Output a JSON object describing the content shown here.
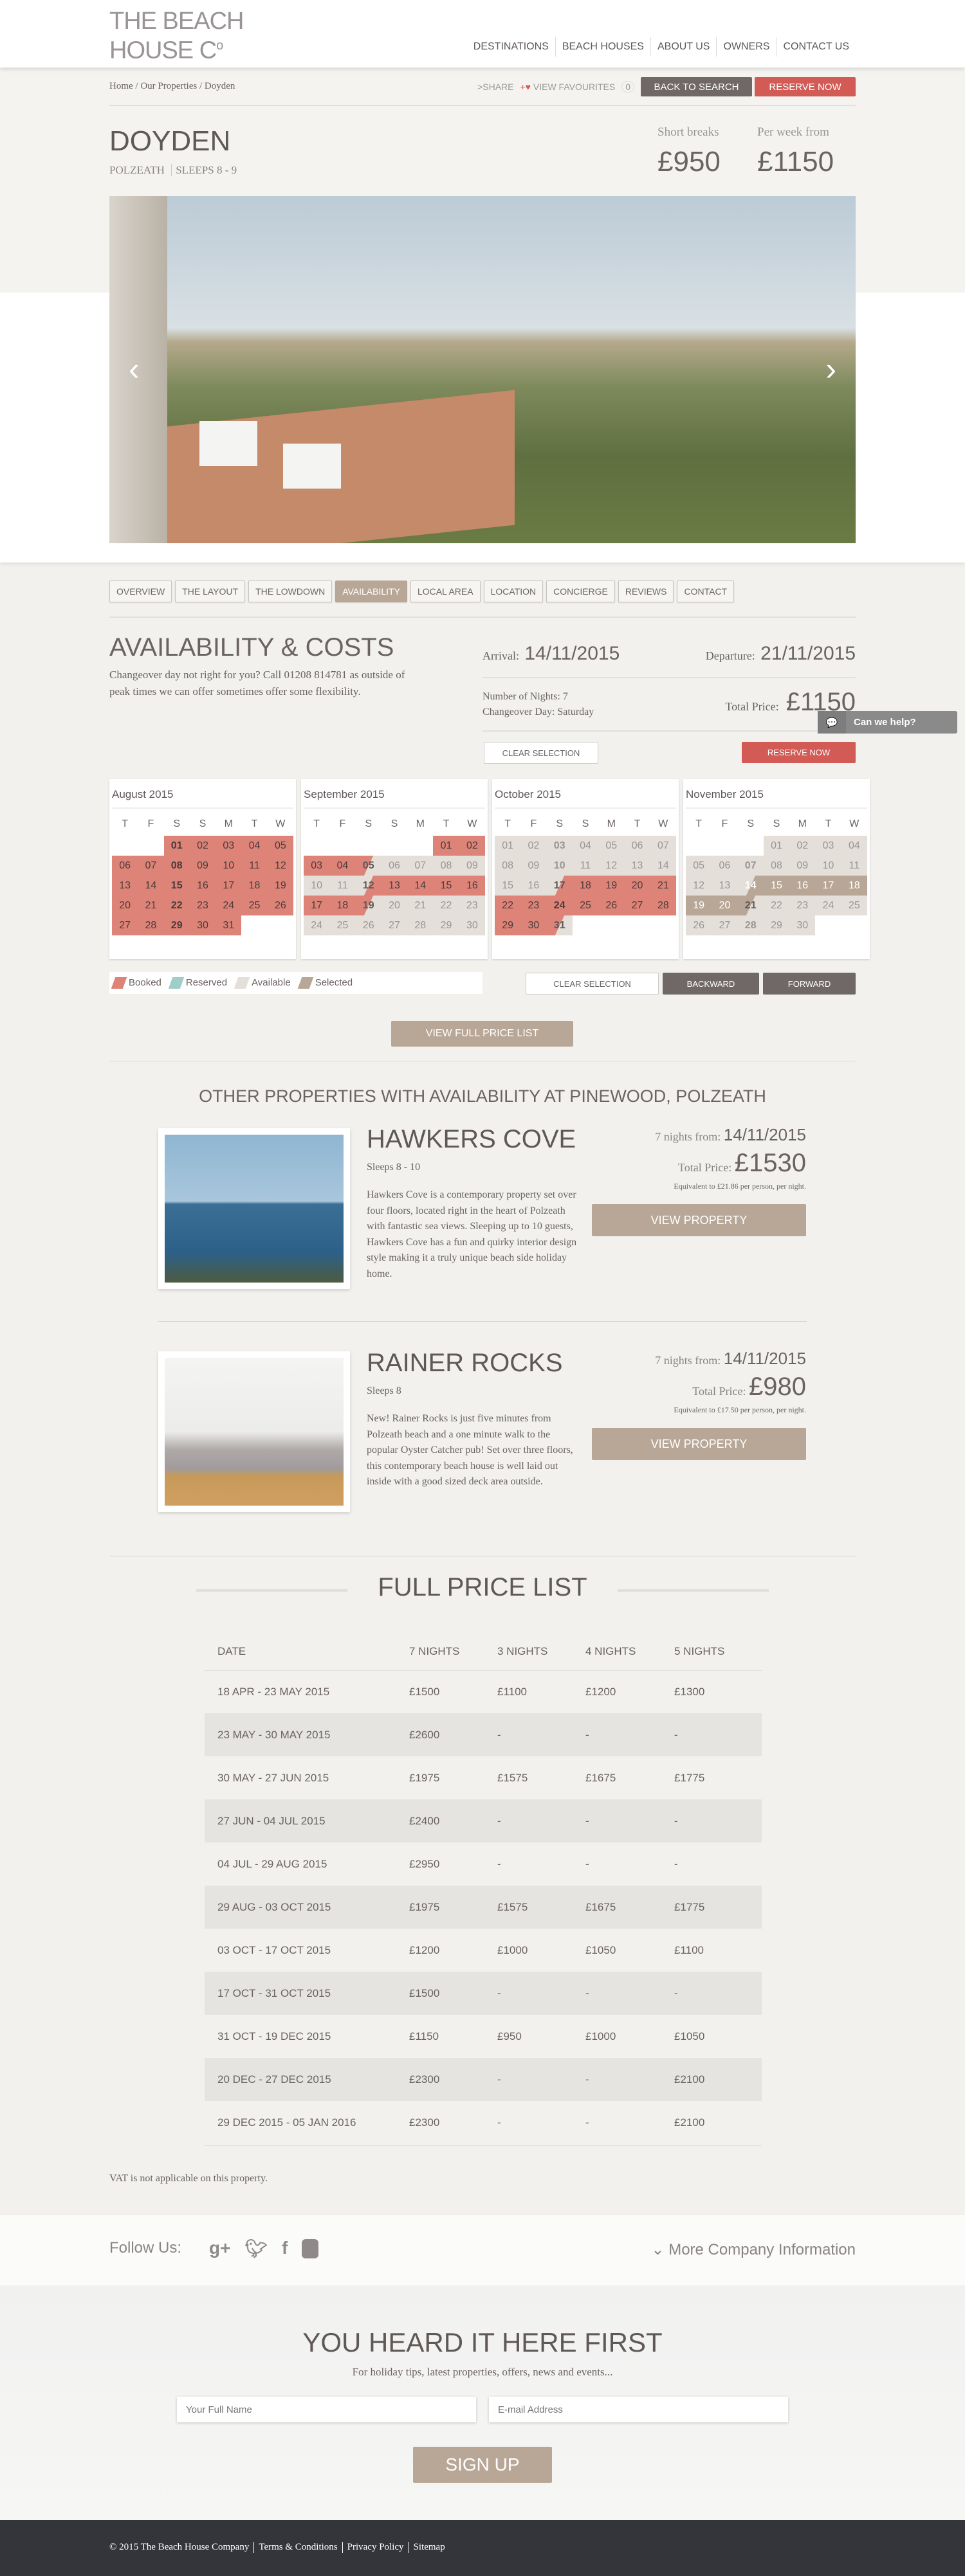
{
  "header": {
    "logo": "THE BEACH HOUSE Co",
    "nav": [
      "DESTINATIONS",
      "BEACH HOUSES",
      "ABOUT US",
      "OWNERS",
      "CONTACT US"
    ]
  },
  "toolbar": {
    "breadcrumb": "Home / Our Properties / Doyden",
    "share": "SHARE",
    "favourites": "VIEW FAVOURITES",
    "fav_count": "0",
    "back": "BACK TO SEARCH",
    "reserve": "RESERVE NOW"
  },
  "property": {
    "name": "DOYDEN",
    "location": "POLZEATH",
    "sleeps": "SLEEPS 8 - 9",
    "short_label": "Short breaks",
    "short_price": "£950",
    "week_label": "Per week from",
    "week_price": "£1150"
  },
  "tabs": [
    "OVERVIEW",
    "THE LAYOUT",
    "THE LOWDOWN",
    "AVAILABILITY",
    "LOCAL AREA",
    "LOCATION",
    "CONCIERGE",
    "REVIEWS",
    "CONTACT"
  ],
  "active_tab": "AVAILABILITY",
  "availability": {
    "title": "AVAILABILITY & COSTS",
    "text": "Changeover day not right for you? Call 01208 814781 as outside of peak times we can offer sometimes offer some flexibility.",
    "arrival_label": "Arrival:",
    "arrival": "14/11/2015",
    "departure_label": "Departure:",
    "departure": "21/11/2015",
    "nights": "Number of Nights: 7",
    "changeover": "Changeover Day: Saturday",
    "total_label": "Total Price:",
    "total": "£1150",
    "clear": "CLEAR SELECTION",
    "reserve": "RESERVE NOW"
  },
  "calendar": {
    "weekdays": [
      "T",
      "F",
      "S",
      "S",
      "M",
      "T",
      "W"
    ],
    "months": [
      {
        "name": "August 2015",
        "offset": 2,
        "states": "B*31",
        "bold": [
          1,
          8,
          15,
          22,
          29
        ]
      },
      {
        "name": "September 2015",
        "offset": 5,
        "states": "B,B,B,B,BA,A,A,A,A,A,A,AB,B,B,B,B,B,B,BA,A,A,A,A,A,A,A,A,A,A,A",
        "bold": [
          5,
          12,
          19
        ]
      },
      {
        "name": "October 2015",
        "offset": 0,
        "states": "A,A,A,A,A,A,A,A,A,A,A,A,A,A,A,A,AB,B,B,B,B,B,B,B,B,B,B,B,B,B,BA",
        "bold": [
          3,
          10,
          17,
          24,
          31
        ]
      },
      {
        "name": "November 2015",
        "offset": 3,
        "states": "A,A,A,A,A,A,A,A,A,A,A,A,A,AS,S,S,S,S,S,S,SA,A,A,A,A,A,A,A,A,A",
        "bold": [
          7,
          14,
          21,
          28
        ]
      }
    ],
    "legend": [
      "Booked",
      "Reserved",
      "Available",
      "Selected"
    ],
    "legend_colors": [
      "#dd8378",
      "#9fcdc8",
      "#e5dfda",
      "#b8a796"
    ],
    "clear": "CLEAR SELECTION",
    "backward": "BACKWARD",
    "forward": "FORWARD",
    "full_list": "VIEW FULL PRICE LIST"
  },
  "others": {
    "title": "OTHER PROPERTIES WITH AVAILABILITY AT PINEWOOD, POLZEATH",
    "items": [
      {
        "name": "HAWKERS COVE",
        "sleeps": "Sleeps 8 - 10",
        "desc": "Hawkers Cove is a contemporary property set over four floors, located right in the heart of Polzeath with fantastic sea views. Sleeping up to 10 guests, Hawkers Cove has a fun and quirky interior design style making it a truly unique beach side holiday home.",
        "from_label": "7 nights from:",
        "from": "14/11/2015",
        "total_label": "Total Price:",
        "total": "£1530",
        "equiv": "Equivalent to £21.86 per person, per night.",
        "button": "VIEW PROPERTY"
      },
      {
        "name": "RAINER ROCKS",
        "sleeps": "Sleeps 8",
        "desc": "New! Rainer Rocks is just five minutes from Polzeath beach and a one minute walk to the popular Oyster Catcher pub! Set over three floors, this contemporary beach house is well laid out inside with a good sized deck area outside.",
        "from_label": "7 nights from:",
        "from": "14/11/2015",
        "total_label": "Total Price:",
        "total": "£980",
        "equiv": "Equivalent to £17.50 per person, per night.",
        "button": "VIEW PROPERTY"
      }
    ]
  },
  "price_list": {
    "title": "FULL PRICE LIST",
    "headers": [
      "DATE",
      "7 NIGHTS",
      "3 NIGHTS",
      "4 NIGHTS",
      "5 NIGHTS"
    ],
    "rows": [
      [
        "18 APR - 23 MAY 2015",
        "£1500",
        "£1100",
        "£1200",
        "£1300"
      ],
      [
        "23 MAY - 30 MAY 2015",
        "£2600",
        "-",
        "-",
        "-"
      ],
      [
        "30 MAY - 27 JUN 2015",
        "£1975",
        "£1575",
        "£1675",
        "£1775"
      ],
      [
        "27 JUN - 04 JUL 2015",
        "£2400",
        "-",
        "-",
        "-"
      ],
      [
        "04 JUL - 29 AUG 2015",
        "£2950",
        "-",
        "-",
        "-"
      ],
      [
        "29 AUG - 03 OCT 2015",
        "£1975",
        "£1575",
        "£1675",
        "£1775"
      ],
      [
        "03 OCT - 17 OCT 2015",
        "£1200",
        "£1000",
        "£1050",
        "£1100"
      ],
      [
        "17 OCT - 31 OCT 2015",
        "£1500",
        "-",
        "-",
        "-"
      ],
      [
        "31 OCT - 19 DEC 2015",
        "£1150",
        "£950",
        "£1000",
        "£1050"
      ],
      [
        "20 DEC - 27 DEC 2015",
        "£2300",
        "-",
        "-",
        "£2100"
      ],
      [
        "29 DEC 2015 - 05 JAN 2016",
        "£2300",
        "-",
        "-",
        "£2100"
      ]
    ],
    "vat": "VAT is not applicable on this property."
  },
  "follow": {
    "label": "Follow Us:",
    "more": "More Company Information"
  },
  "newsletter": {
    "title": "YOU HEARD IT HERE FIRST",
    "text": "For holiday tips, latest properties, offers, news and events...",
    "name_placeholder": "Your Full Name",
    "email_placeholder": "E-mail Address",
    "button": "SIGN UP"
  },
  "footer": {
    "links": [
      "© 2015 The Beach House Company",
      "Terms & Conditions",
      "Privacy Policy",
      "Sitemap"
    ]
  },
  "chat": {
    "label": "Can we help?"
  }
}
